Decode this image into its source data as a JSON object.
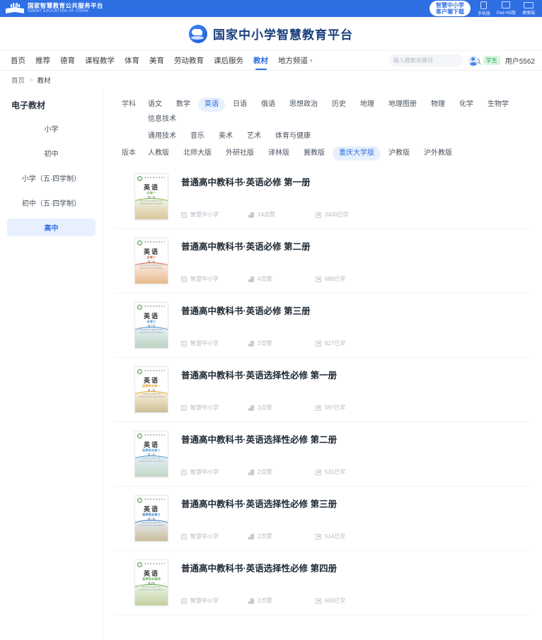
{
  "topbar": {
    "brand_cn": "国家智慧教育公共服务平台",
    "brand_en": "SMART EDUCATION OF CHINA",
    "download_line1": "智慧中小学",
    "download_line2": "客户端下载",
    "devices": [
      {
        "label": "手机版",
        "icon": "phone-icon"
      },
      {
        "label": "Pad HD版",
        "icon": "tablet-icon"
      },
      {
        "label": "桌面端",
        "icon": "desktop-icon"
      }
    ],
    "accent": "#2f6fe4"
  },
  "header": {
    "title": "国家中小学智慧教育平台",
    "logo": "cloud-logo"
  },
  "nav": {
    "items": [
      {
        "label": "首页",
        "active": false
      },
      {
        "label": "推荐",
        "active": false
      },
      {
        "label": "德育",
        "active": false
      },
      {
        "label": "课程教学",
        "active": false
      },
      {
        "label": "体育",
        "active": false
      },
      {
        "label": "美育",
        "active": false
      },
      {
        "label": "劳动教育",
        "active": false
      },
      {
        "label": "课后服务",
        "active": false
      },
      {
        "label": "教材",
        "active": true
      },
      {
        "label": "地方频道",
        "active": false,
        "caret": true
      }
    ],
    "search": {
      "placeholder": "输入搜索关键词",
      "value": ""
    },
    "user": {
      "role_badge": "学生",
      "name": "用户5562"
    }
  },
  "breadcrumb": {
    "home": "首页",
    "separator": ">",
    "current": "教材"
  },
  "sidebar": {
    "title": "电子教材",
    "items": [
      {
        "label": "小学",
        "active": false
      },
      {
        "label": "初中",
        "active": false
      },
      {
        "label": "小学（五·四学制）",
        "active": false
      },
      {
        "label": "初中（五·四学制）",
        "active": false
      },
      {
        "label": "高中",
        "active": true
      }
    ]
  },
  "filters": {
    "subject": {
      "label": "学科",
      "row1": [
        {
          "label": "语文",
          "active": false
        },
        {
          "label": "数学",
          "active": false
        },
        {
          "label": "英语",
          "active": true
        },
        {
          "label": "日语",
          "active": false
        },
        {
          "label": "俄语",
          "active": false
        },
        {
          "label": "思想政治",
          "active": false
        },
        {
          "label": "历史",
          "active": false
        },
        {
          "label": "地理",
          "active": false
        },
        {
          "label": "地理图册",
          "active": false
        },
        {
          "label": "物理",
          "active": false
        },
        {
          "label": "化学",
          "active": false
        },
        {
          "label": "生物学",
          "active": false
        },
        {
          "label": "信息技术",
          "active": false
        }
      ],
      "row2": [
        {
          "label": "通用技术",
          "active": false
        },
        {
          "label": "音乐",
          "active": false
        },
        {
          "label": "美术",
          "active": false
        },
        {
          "label": "艺术",
          "active": false
        },
        {
          "label": "体育与健康",
          "active": false
        }
      ]
    },
    "version": {
      "label": "版本",
      "options": [
        {
          "label": "人教版",
          "active": false
        },
        {
          "label": "北师大版",
          "active": false
        },
        {
          "label": "外研社版",
          "active": false
        },
        {
          "label": "译林版",
          "active": false
        },
        {
          "label": "冀教版",
          "active": false
        },
        {
          "label": "重庆大学版",
          "active": true
        },
        {
          "label": "沪教版",
          "active": false
        },
        {
          "label": "沪外教版",
          "active": false
        }
      ]
    }
  },
  "books": [
    {
      "title": "普通高中教科书·英语必修 第一册",
      "source": "智慧中小学",
      "likes": "14点赞",
      "studied": "2430已学",
      "cover": {
        "name": "英语",
        "sub": "必修一",
        "sub2": "第一册",
        "en": "ENGLISH  COMPULSORY  EDUCATION  TEXTBOOK",
        "accent": "#6fae4a",
        "art_top": "#f0f5e4",
        "art_bottom": "#d8c79a"
      }
    },
    {
      "title": "普通高中教科书·英语必修 第二册",
      "source": "智慧中小学",
      "likes": "4点赞",
      "studied": "686已学",
      "cover": {
        "name": "英语",
        "sub": "必修二",
        "sub2": "第二册",
        "en": "ENGLISH  COMPULSORY  EDUCATION  TEXTBOOK",
        "accent": "#c8503c",
        "art_top": "#faeee6",
        "art_bottom": "#e8b98c"
      }
    },
    {
      "title": "普通高中教科书·英语必修 第三册",
      "source": "智慧中小学",
      "likes": "2点赞",
      "studied": "627已学",
      "cover": {
        "name": "英语",
        "sub": "必修三",
        "sub2": "第三册",
        "en": "ENGLISH  COMPULSORY  EDUCATION  TEXTBOOK",
        "accent": "#3d8ec9",
        "art_top": "#e4f0f8",
        "art_bottom": "#bcd4c0"
      }
    },
    {
      "title": "普通高中教科书·英语选择性必修 第一册",
      "source": "智慧中小学",
      "likes": "3点赞",
      "studied": "597已学",
      "cover": {
        "name": "英语",
        "sub": "选择性必修一",
        "sub2": "第一册",
        "en": "ENGLISH  ELECTIVE  COMPULSORY  TEXTBOOK",
        "accent": "#e0a32c",
        "art_top": "#fbf2dc",
        "art_bottom": "#cdbf96"
      }
    },
    {
      "title": "普通高中教科书·英语选择性必修 第二册",
      "source": "智慧中小学",
      "likes": "2点赞",
      "studied": "531已学",
      "cover": {
        "name": "英语",
        "sub": "选择性必修二",
        "sub2": "第二册",
        "en": "ENGLISH  ELECTIVE  COMPULSORY  TEXTBOOK",
        "accent": "#3d8ec9",
        "art_top": "#e6f1fa",
        "art_bottom": "#c3d6c4"
      }
    },
    {
      "title": "普通高中教科书·英语选择性必修 第三册",
      "source": "智慧中小学",
      "likes": "2点赞",
      "studied": "514已学",
      "cover": {
        "name": "英语",
        "sub": "选择性必修三",
        "sub2": "第三册",
        "en": "ENGLISH  ELECTIVE  COMPULSORY  TEXTBOOK",
        "accent": "#2f6fb8",
        "art_top": "#e3eef9",
        "art_bottom": "#cbbd98"
      }
    },
    {
      "title": "普通高中教科书·英语选择性必修 第四册",
      "source": "智慧中小学",
      "likes": "2点赞",
      "studied": "609已学",
      "cover": {
        "name": "英语",
        "sub": "选择性必修四",
        "sub2": "第四册",
        "en": "ENGLISH  ELECTIVE  COMPULSORY  TEXTBOOK",
        "accent": "#5aa44e",
        "art_top": "#eef7ea",
        "art_bottom": "#c2cf9f"
      }
    }
  ]
}
